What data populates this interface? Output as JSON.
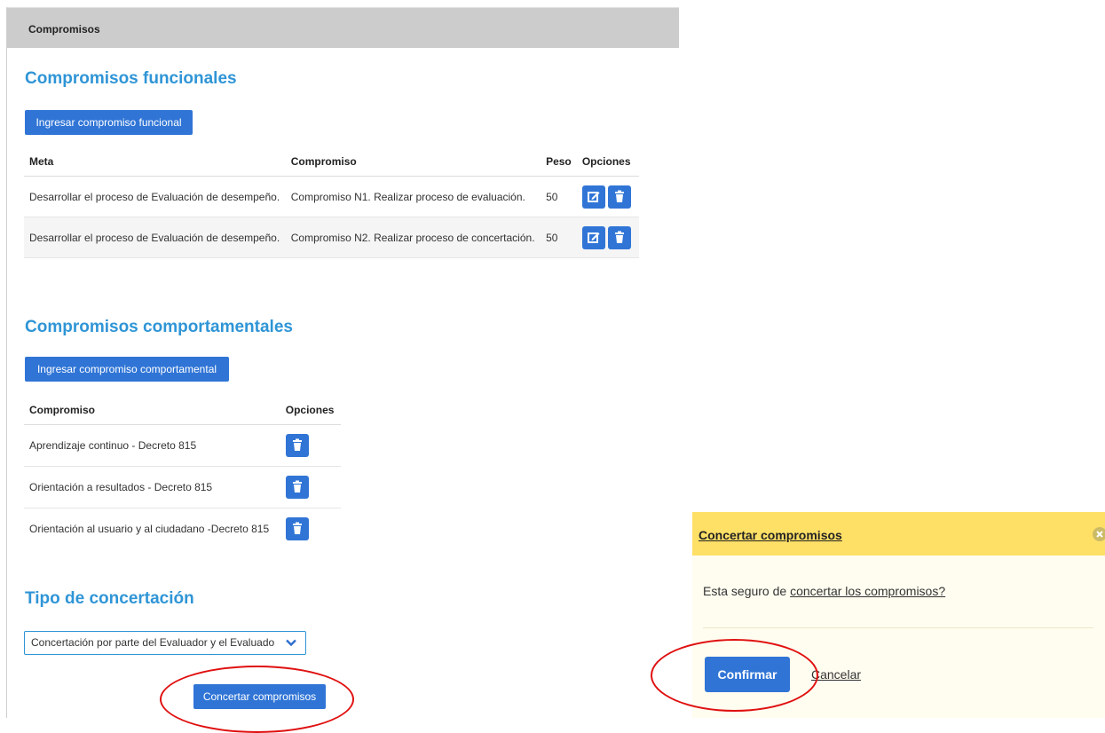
{
  "header": {
    "title": "Compromisos"
  },
  "funcionales": {
    "title": "Compromisos funcionales",
    "add_button": "Ingresar compromiso funcional",
    "columns": [
      "Meta",
      "Compromiso",
      "Peso",
      "Opciones"
    ],
    "rows": [
      {
        "meta": "Desarrollar el proceso de Evaluación de desempeño.",
        "compromiso": "Compromiso N1. Realizar proceso de evaluación.",
        "peso": "50"
      },
      {
        "meta": "Desarrollar el proceso de Evaluación de desempeño.",
        "compromiso": "Compromiso N2. Realizar proceso de concertación.",
        "peso": "50"
      }
    ]
  },
  "comportamentales": {
    "title": "Compromisos comportamentales",
    "add_button": "Ingresar compromiso comportamental",
    "columns": [
      "Compromiso",
      "Opciones"
    ],
    "rows": [
      {
        "compromiso": "Aprendizaje continuo - Decreto 815"
      },
      {
        "compromiso": "Orientación a resultados - Decreto 815"
      },
      {
        "compromiso": "Orientación al usuario y al ciudadano -Decreto 815"
      }
    ]
  },
  "concertacion": {
    "title": "Tipo de concertación",
    "selected": "Concertación por parte del Evaluador y el Evaluado",
    "submit_button": "Concertar compromisos"
  },
  "dialog": {
    "title": "Concertar compromisos",
    "message_prefix": "Esta seguro de ",
    "message_link": "concertar los compromisos?",
    "confirm": "Confirmar",
    "cancel": "Cancelar"
  },
  "colors": {
    "primary": "#3075d6",
    "heading": "#2f95d6",
    "dialog_header": "#ffe066",
    "annotation": "#e01010"
  }
}
